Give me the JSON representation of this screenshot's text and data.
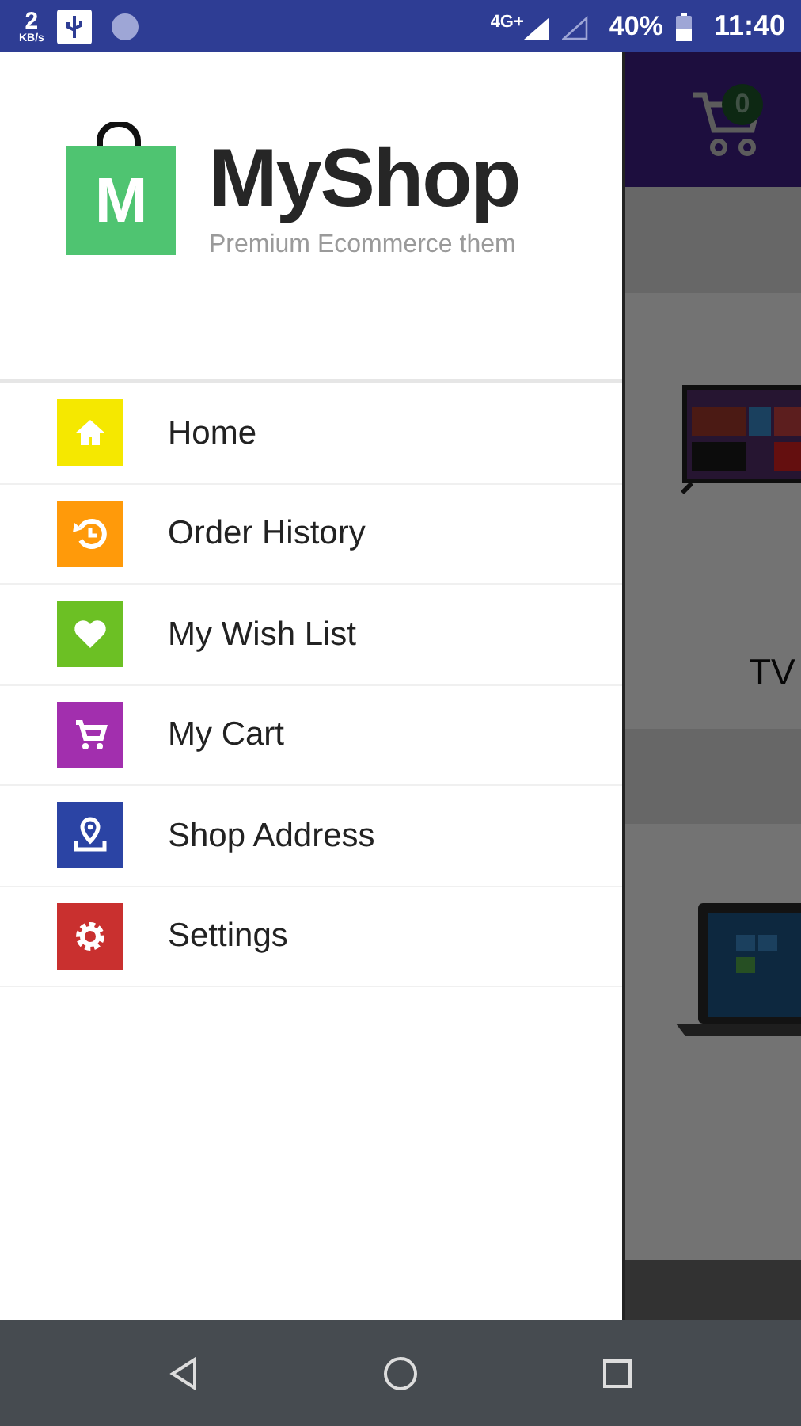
{
  "status_bar": {
    "speed": "2",
    "speed_unit": "KB/s",
    "network": "4G+",
    "battery": "40%",
    "time": "11:40"
  },
  "drawer": {
    "logo_letter": "M",
    "brand": "MyShop",
    "tagline": "Premium Ecommerce them",
    "items": [
      {
        "kind": "home",
        "label": "Home",
        "color": "#f5e800"
      },
      {
        "kind": "history",
        "label": "Order History",
        "color": "#ff9a0a"
      },
      {
        "kind": "heart",
        "label": "My Wish List",
        "color": "#6cc024"
      },
      {
        "kind": "cart",
        "label": "My Cart",
        "color": "#a22fae"
      },
      {
        "kind": "location",
        "label": "Shop Address",
        "color": "#2b44a4"
      },
      {
        "kind": "settings",
        "label": "Settings",
        "color": "#c9302f"
      }
    ]
  },
  "background": {
    "cart_count": "0",
    "products": [
      {
        "kind": "tv",
        "label": "TV"
      },
      {
        "kind": "laptop"
      }
    ]
  }
}
